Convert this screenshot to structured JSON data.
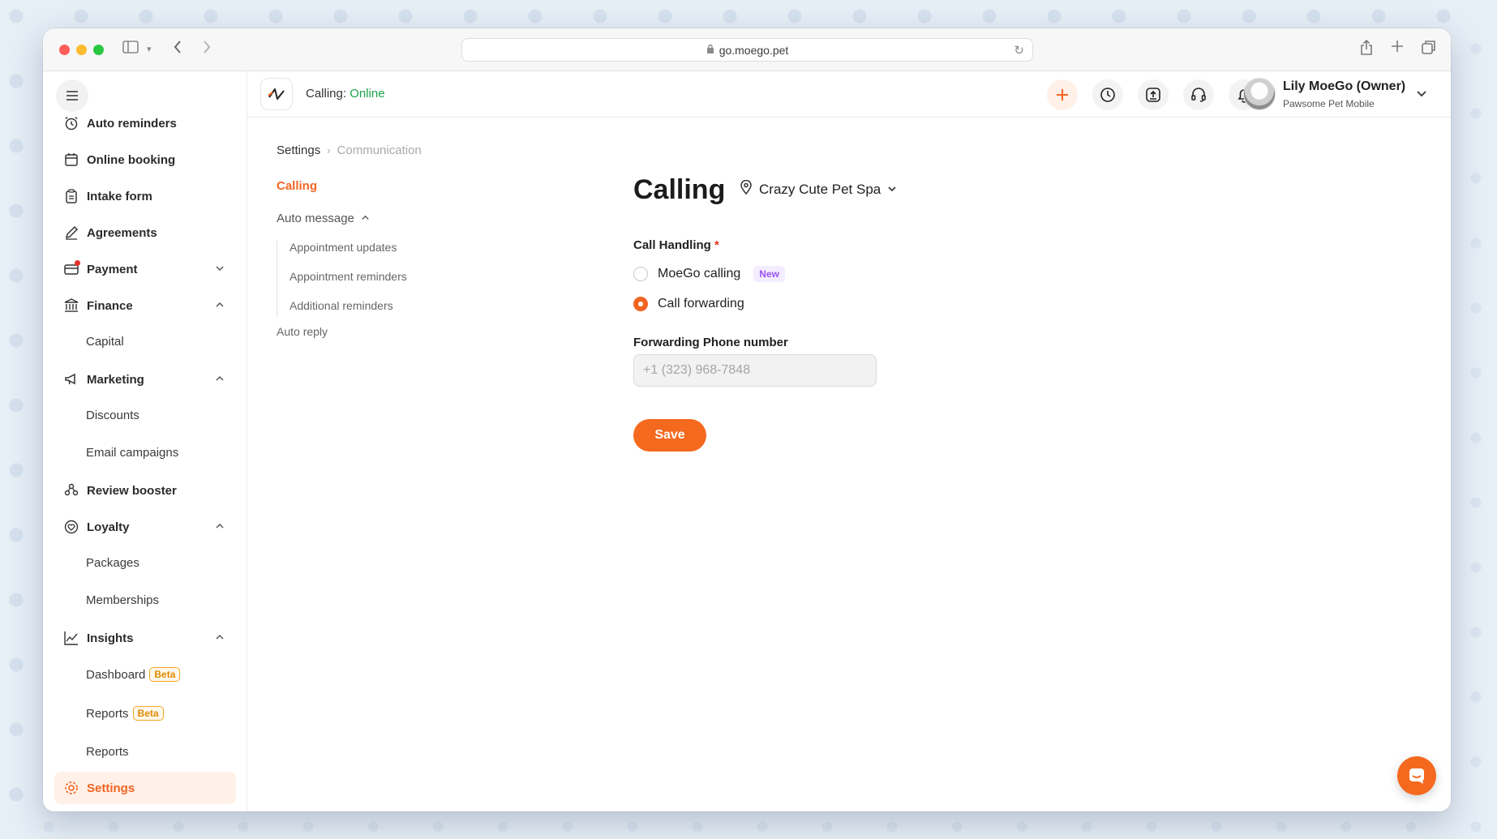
{
  "browser": {
    "url": "go.moego.pet"
  },
  "topbar": {
    "calling_label": "Calling:",
    "calling_status": "Online",
    "user_name": "Lily MoeGo (Owner)",
    "business_name": "Pawsome Pet Mobile"
  },
  "sidebar": {
    "items": [
      {
        "label": "Auto reminders"
      },
      {
        "label": "Online booking"
      },
      {
        "label": "Intake form"
      },
      {
        "label": "Agreements"
      },
      {
        "label": "Payment"
      },
      {
        "label": "Finance"
      },
      {
        "label": "Capital"
      },
      {
        "label": "Marketing"
      },
      {
        "label": "Discounts"
      },
      {
        "label": "Email campaigns"
      },
      {
        "label": "Review booster"
      },
      {
        "label": "Loyalty"
      },
      {
        "label": "Packages"
      },
      {
        "label": "Memberships"
      },
      {
        "label": "Insights"
      },
      {
        "label": "Dashboard",
        "badge": "Beta"
      },
      {
        "label": "Reports",
        "badge": "Beta"
      },
      {
        "label": "Reports"
      },
      {
        "label": "Settings"
      }
    ]
  },
  "breadcrumb": {
    "root": "Settings",
    "current": "Communication"
  },
  "subnav": {
    "calling": "Calling",
    "auto_message": "Auto message",
    "children": [
      "Appointment updates",
      "Appointment reminders",
      "Additional reminders"
    ],
    "auto_reply": "Auto reply"
  },
  "main": {
    "title": "Calling",
    "location": "Crazy Cute Pet Spa",
    "call_handling_label": "Call Handling",
    "required_mark": "*",
    "options": [
      {
        "label": "MoeGo calling",
        "badge": "New",
        "checked": false
      },
      {
        "label": "Call forwarding",
        "checked": true
      }
    ],
    "forwarding_label": "Forwarding Phone number",
    "phone_placeholder": "+1 (323) 968-7848",
    "save_label": "Save"
  },
  "colors": {
    "accent": "#f26422",
    "online": "#1aa34a",
    "beta": "#f5a623",
    "new_badge": "#9a55f0"
  }
}
